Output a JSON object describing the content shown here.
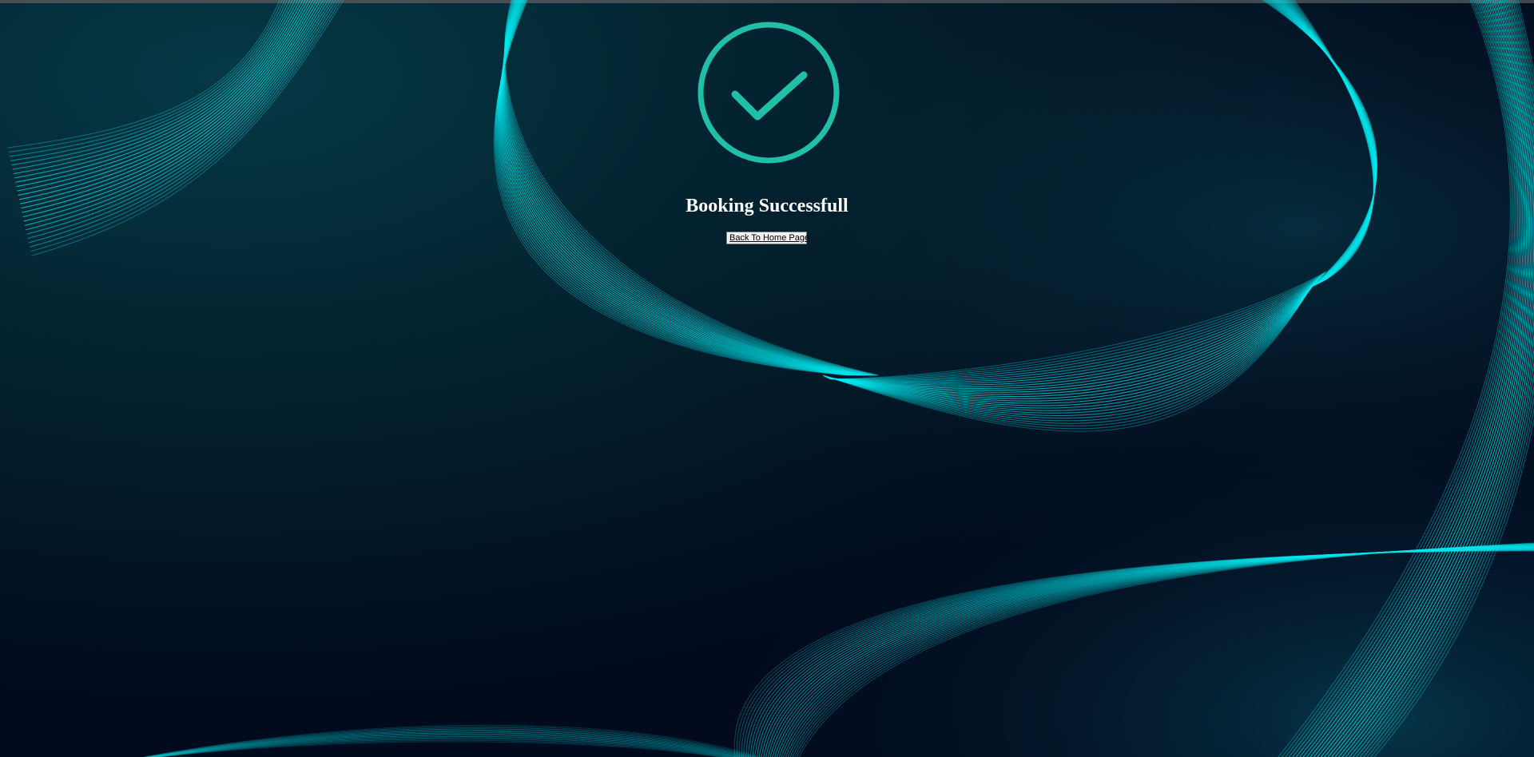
{
  "page": {
    "status_icon": "check-circle-icon",
    "title": "Booking Successfull",
    "home_button_label": "Back To Home Page"
  },
  "colors": {
    "background_dark": "#010a1e",
    "background_teal": "#053845",
    "wave_cyan": "#00f0f0",
    "check_green": "#20c0a8",
    "title_text": "#ffffff",
    "button_face": "#f0f0f0"
  }
}
